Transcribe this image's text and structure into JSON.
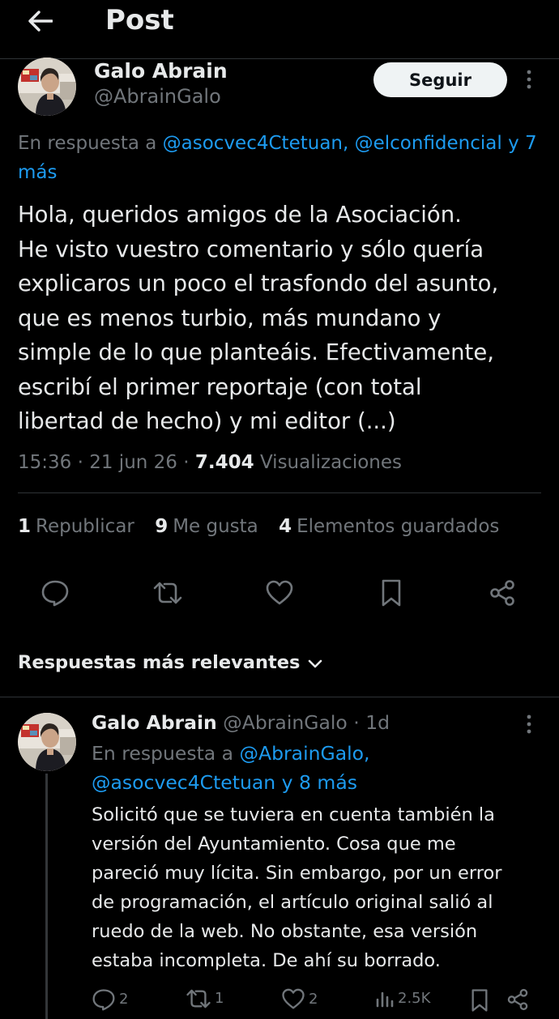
{
  "header": {
    "title": "Post"
  },
  "post": {
    "author_name": "Galo Abrain",
    "author_handle": "@AbrainGalo",
    "follow_label": "Seguir",
    "reply_prefix": "En respuesta a ",
    "reply_mentions": "@asocvec4Ctetuan, @elconfidencial y 7",
    "reply_more": "más",
    "text_lines": [
      "Hola, queridos amigos de la Asociación.",
      "He visto vuestro comentario y sólo quería",
      "explicaros un poco el trasfondo del asunto,",
      "que es menos turbio, más mundano y",
      "simple de lo que planteáis. Efectivamente,",
      "escribí el primer reportaje (con total",
      "libertad de hecho) y mi editor (...)"
    ],
    "time": "15:36",
    "date": "21 jun 26",
    "views_count": "7.404",
    "views_label": "Visualizaciones",
    "reposts_count": "1",
    "reposts_label": "Republicar",
    "likes_count": "9",
    "likes_label": "Me gusta",
    "bookmarks_count": "4",
    "bookmarks_label": "Elementos guardados"
  },
  "sort": {
    "label": "Respuestas más relevantes"
  },
  "reply": {
    "author_name": "Galo Abrain",
    "author_handle": "@AbrainGalo",
    "time_ago": "1d",
    "reply_prefix": "En respuesta a ",
    "mention_1": "@AbrainGalo,",
    "mention_2": "@asocvec4Ctetuan y 8 más",
    "text_lines": [
      "Solicitó que se tuviera en cuenta también la",
      "versión del Ayuntamiento. Cosa que me",
      "pareció muy lícita. Sin embargo, por un error",
      "de programación, el artículo original salió al",
      "ruedo de la web. No obstante, esa versión",
      "estaba incompleta. De ahí su borrado."
    ],
    "replies_count": "2",
    "reposts_count": "1",
    "likes_count": "2",
    "views_count": "2.5K"
  },
  "icons": {
    "back": "arrow-left-icon",
    "more": "more-vertical-icon",
    "reply": "speech-bubble-icon",
    "repost": "repost-arrows-icon",
    "like": "heart-icon",
    "bookmark": "bookmark-icon",
    "share": "share-icon",
    "views": "bar-chart-icon",
    "chevron": "chevron-down-icon"
  },
  "colors": {
    "background": "#000000",
    "text": "#e7e9ea",
    "secondary": "#71767b",
    "accent": "#1d9bf0",
    "divider": "#2f3336"
  }
}
